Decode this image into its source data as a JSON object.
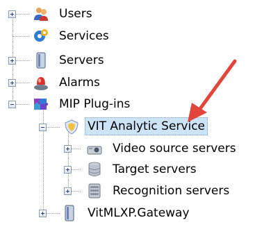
{
  "tree": {
    "items": [
      {
        "label": "Users",
        "icon": "users-icon",
        "expander": "plus"
      },
      {
        "label": "Services",
        "icon": "services-icon",
        "expander": "none"
      },
      {
        "label": "Servers",
        "icon": "servers-icon",
        "expander": "plus"
      },
      {
        "label": "Alarms",
        "icon": "alarms-icon",
        "expander": "plus"
      },
      {
        "label": "MIP Plug-ins",
        "icon": "puzzle-icon",
        "expander": "minus"
      },
      {
        "label": "VIT Analytic Service",
        "icon": "shield-icon",
        "expander": "minus",
        "selected": true
      },
      {
        "label": "Video source servers",
        "icon": "camera-icon",
        "expander": "plus"
      },
      {
        "label": "Target servers",
        "icon": "database-icon",
        "expander": "plus"
      },
      {
        "label": "Recognition servers",
        "icon": "server-stack-icon",
        "expander": "plus"
      },
      {
        "label": "VitMLXP.Gateway",
        "icon": "servers-icon",
        "expander": "plus"
      }
    ]
  },
  "annotation": {
    "arrow_color": "#e0463a"
  }
}
